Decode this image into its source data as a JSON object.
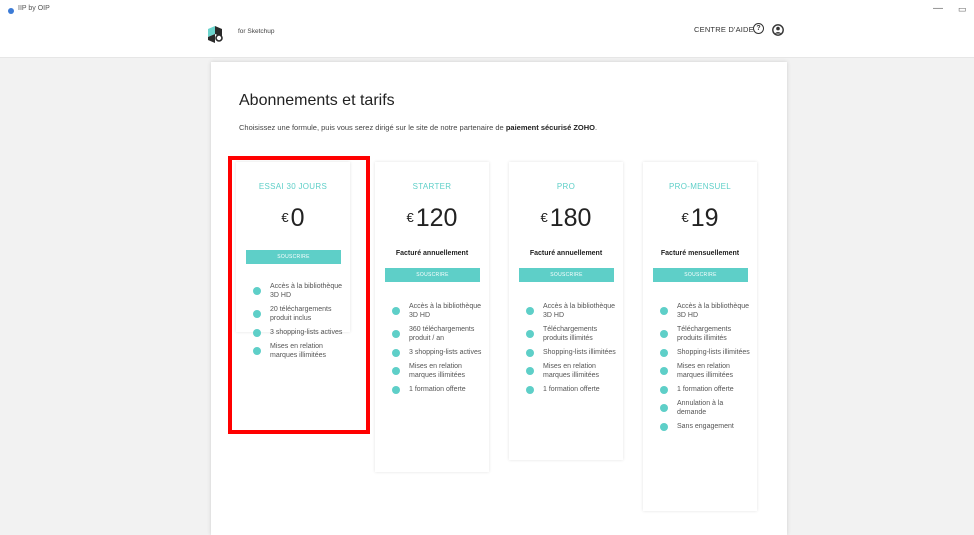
{
  "window": {
    "app_name": "IIP by OIP",
    "minimize": "—",
    "maximize": "▭"
  },
  "header": {
    "logo_subtitle": "for Sketchup",
    "help_label": "CENTRE D'AIDE",
    "help_icon": "question-circle-icon",
    "account_icon": "user-circle-icon"
  },
  "page": {
    "title": "Abonnements et tarifs",
    "subtitle_start": "Choisissez une formule, puis vous serez dirigé sur le site de notre partenaire de ",
    "subtitle_bold": "paiement sécurisé ZOHO",
    "subtitle_end": "."
  },
  "colors": {
    "accent": "#5ecfc8",
    "highlight": "#ff0000"
  },
  "plans": [
    {
      "name": "ESSAI 30 JOURS",
      "currency": "€",
      "price": "0",
      "billing": "",
      "button": "SOUSCRIRE",
      "features": [
        "Accès à la bibliothèque 3D HD",
        "20 téléchargements produit inclus",
        "3 shopping-lists actives",
        "Mises en relation marques illimitées"
      ]
    },
    {
      "name": "STARTER",
      "currency": "€",
      "price": "120",
      "billing": "Facturé annuellement",
      "button": "SOUSCRIRE",
      "features": [
        "Accès à la bibliothèque 3D HD",
        "360 téléchargements produit / an",
        "3 shopping-lists actives",
        "Mises en relation marques illimitées",
        "1 formation offerte"
      ]
    },
    {
      "name": "PRO",
      "currency": "€",
      "price": "180",
      "billing": "Facturé annuellement",
      "button": "SOUSCRIRE",
      "features": [
        "Accès à la bibliothèque 3D HD",
        "Téléchargements produits illimités",
        "Shopping-lists illimitées",
        "Mises en relation marques illimitées",
        "1 formation offerte"
      ]
    },
    {
      "name": "PRO-MENSUEL",
      "currency": "€",
      "price": "19",
      "billing": "Facturé mensuellement",
      "button": "SOUSCRIRE",
      "features": [
        "Accès à la bibliothèque 3D HD",
        "Téléchargements produits illimités",
        "Shopping-lists illimitées",
        "Mises en relation marques illimitées",
        "1 formation offerte",
        "Annulation à la demande",
        "Sans engagement"
      ]
    }
  ]
}
